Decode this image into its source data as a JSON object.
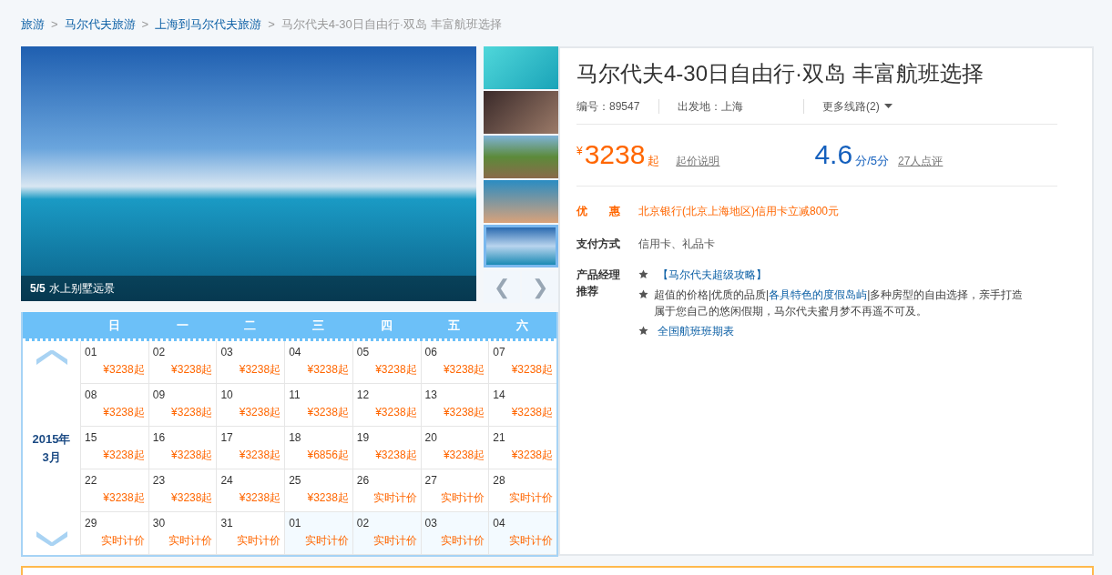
{
  "breadcrumb": [
    {
      "label": "旅游",
      "link": true
    },
    {
      "label": "马尔代夫旅游",
      "link": true
    },
    {
      "label": "上海到马尔代夫旅游",
      "link": true
    },
    {
      "label": "马尔代夫4-30日自由行·双岛 丰富航班选择",
      "link": false
    }
  ],
  "breadcrumb_separator": ">",
  "gallery": {
    "counter": "5/5",
    "caption": "水上别墅远景",
    "prev": "❮",
    "next": "❯",
    "thumbnails": [
      {
        "selected": false
      },
      {
        "selected": false
      },
      {
        "selected": false
      },
      {
        "selected": false
      },
      {
        "selected": true
      }
    ]
  },
  "product": {
    "title": "马尔代夫4-30日自由行·双岛 丰富航班选择",
    "code_label": "编号：",
    "code": "89547",
    "departure_label": "出发地：",
    "departure": "上海",
    "more_routes": "更多线路(2)",
    "currency": "¥",
    "price": "3238",
    "price_suffix": "起",
    "price_note": "起价说明",
    "score": "4.6",
    "score_suffix": "分/5分",
    "reviews": "27人点评",
    "discount_label": "优　　惠",
    "discount": "北京银行(北京上海地区)信用卡立减800元",
    "payment_label": "支付方式",
    "payment": "信用卡、礼品卡",
    "recommend_label": "产品经理推荐",
    "recommendations": [
      {
        "kind": "link",
        "text": "【马尔代夫超级攻略】"
      },
      {
        "kind": "mixed",
        "parts": [
          {
            "text": "超值的价格|优质的品质|",
            "link": false
          },
          {
            "text": "各具特色的度假岛屿",
            "link": true
          },
          {
            "text": "|多种房型的自由选择，亲手打造属于您自己的悠闲假期，马尔代夫蜜月梦不再遥不可及。",
            "link": false
          }
        ]
      },
      {
        "kind": "link",
        "text": "全国航班班期表"
      }
    ]
  },
  "calendar": {
    "weekdays": [
      "日",
      "一",
      "二",
      "三",
      "四",
      "五",
      "六"
    ],
    "month": "2015年3月",
    "weeks": [
      [
        {
          "day": "01",
          "price": "¥3238起",
          "other_month": false
        },
        {
          "day": "02",
          "price": "¥3238起",
          "other_month": false
        },
        {
          "day": "03",
          "price": "¥3238起",
          "other_month": false
        },
        {
          "day": "04",
          "price": "¥3238起",
          "other_month": false
        },
        {
          "day": "05",
          "price": "¥3238起",
          "other_month": false
        },
        {
          "day": "06",
          "price": "¥3238起",
          "other_month": false
        },
        {
          "day": "07",
          "price": "¥3238起",
          "other_month": false
        }
      ],
      [
        {
          "day": "08",
          "price": "¥3238起",
          "other_month": false
        },
        {
          "day": "09",
          "price": "¥3238起",
          "other_month": false
        },
        {
          "day": "10",
          "price": "¥3238起",
          "other_month": false
        },
        {
          "day": "11",
          "price": "¥3238起",
          "other_month": false
        },
        {
          "day": "12",
          "price": "¥3238起",
          "other_month": false
        },
        {
          "day": "13",
          "price": "¥3238起",
          "other_month": false
        },
        {
          "day": "14",
          "price": "¥3238起",
          "other_month": false
        }
      ],
      [
        {
          "day": "15",
          "price": "¥3238起",
          "other_month": false
        },
        {
          "day": "16",
          "price": "¥3238起",
          "other_month": false
        },
        {
          "day": "17",
          "price": "¥3238起",
          "other_month": false
        },
        {
          "day": "18",
          "price": "¥6856起",
          "other_month": false
        },
        {
          "day": "19",
          "price": "¥3238起",
          "other_month": false
        },
        {
          "day": "20",
          "price": "¥3238起",
          "other_month": false
        },
        {
          "day": "21",
          "price": "¥3238起",
          "other_month": false
        }
      ],
      [
        {
          "day": "22",
          "price": "¥3238起",
          "other_month": false
        },
        {
          "day": "23",
          "price": "¥3238起",
          "other_month": false
        },
        {
          "day": "24",
          "price": "¥3238起",
          "other_month": false
        },
        {
          "day": "25",
          "price": "¥3238起",
          "other_month": false
        },
        {
          "day": "26",
          "price": "实时计价",
          "other_month": false
        },
        {
          "day": "27",
          "price": "实时计价",
          "other_month": false
        },
        {
          "day": "28",
          "price": "实时计价",
          "other_month": false
        }
      ],
      [
        {
          "day": "29",
          "price": "实时计价",
          "other_month": false
        },
        {
          "day": "30",
          "price": "实时计价",
          "other_month": false
        },
        {
          "day": "31",
          "price": "实时计价",
          "other_month": false
        },
        {
          "day": "01",
          "price": "实时计价",
          "other_month": true
        },
        {
          "day": "02",
          "price": "实时计价",
          "other_month": true
        },
        {
          "day": "03",
          "price": "实时计价",
          "other_month": true
        },
        {
          "day": "04",
          "price": "实时计价",
          "other_month": true
        }
      ]
    ]
  }
}
